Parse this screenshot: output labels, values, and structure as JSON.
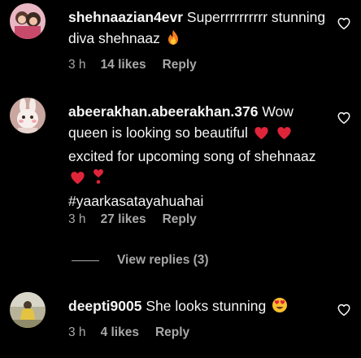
{
  "comments": [
    {
      "username": "shehnaazian4evr",
      "text": "Superrrrrrrrrr stunning diva shehnaaz",
      "emoji": "fire",
      "time": "3 h",
      "likes": "14 likes",
      "reply": "Reply"
    },
    {
      "username": "abeerakhan.abeerakhan.376",
      "text_parts": [
        "Wow queen is looking so beautiful",
        "excited for upcoming song of shehnaaz",
        "#yaarkasatayahuahai"
      ],
      "time": "3 h",
      "likes": "27 likes",
      "reply": "Reply",
      "view_replies": "View replies (3)"
    },
    {
      "username": "deepti9005",
      "text": "She looks stunning",
      "emoji": "heart-eyes",
      "time": "3 h",
      "likes": "4 likes",
      "reply": "Reply"
    }
  ],
  "icons": {
    "like": "heart-outline-icon"
  },
  "colors": {
    "background": "#000000",
    "text": "#f5f5f5",
    "secondary": "#a8a8a8",
    "red_heart": "#e0243a"
  }
}
